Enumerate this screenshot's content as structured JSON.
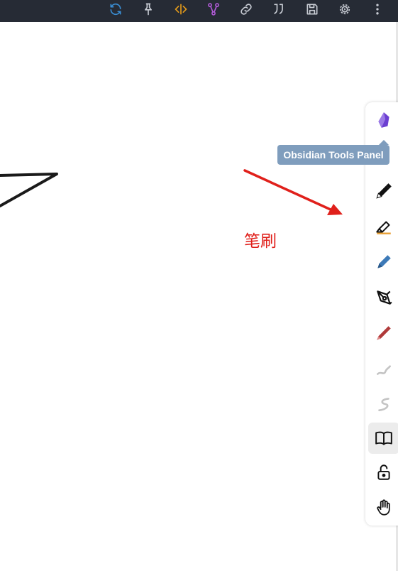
{
  "toolbar": {
    "buttons": [
      {
        "name": "sync-icon",
        "color": "#3a8fd6"
      },
      {
        "name": "pin-icon",
        "color": "#c8ccd4"
      },
      {
        "name": "code-split-icon",
        "color": "#e39a1a"
      },
      {
        "name": "graph-icon",
        "color": "#b05ad6"
      },
      {
        "name": "link-icon",
        "color": "#c8ccd4"
      },
      {
        "name": "quote-icon",
        "color": "#c8ccd4"
      },
      {
        "name": "save-icon",
        "color": "#c8ccd4"
      },
      {
        "name": "settings-icon",
        "color": "#c8ccd4"
      },
      {
        "name": "more-vertical-icon",
        "color": "#c8ccd4"
      }
    ]
  },
  "tooltip": {
    "text": "Obsidian Tools Panel"
  },
  "annotation": {
    "text": "笔刷",
    "color": "#e0201b"
  },
  "tools_panel": {
    "tools": [
      {
        "name": "obsidian-logo-icon"
      },
      {
        "name": "pen-icon"
      },
      {
        "name": "highlighter-icon"
      },
      {
        "name": "pencil-icon"
      },
      {
        "name": "fountain-pen-icon"
      },
      {
        "name": "marker-icon",
        "color": "#b03a3a"
      },
      {
        "name": "stroke-icon"
      },
      {
        "name": "stroke-icon"
      },
      {
        "name": "book-icon",
        "active": true
      },
      {
        "name": "unlock-icon"
      },
      {
        "name": "hand-icon"
      }
    ]
  }
}
